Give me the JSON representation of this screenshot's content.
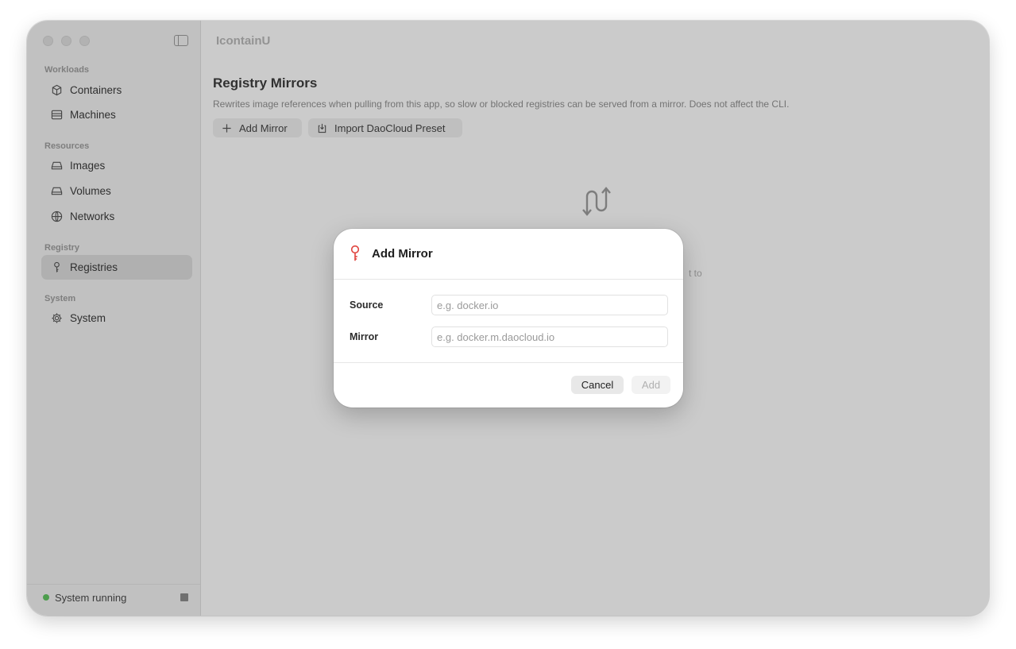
{
  "window": {
    "app_title": "IcontainU"
  },
  "sidebar": {
    "sections": [
      {
        "label": "Workloads",
        "items": [
          {
            "label": "Containers",
            "icon": "cube-icon"
          },
          {
            "label": "Machines",
            "icon": "server-icon"
          }
        ]
      },
      {
        "label": "Resources",
        "items": [
          {
            "label": "Images",
            "icon": "drive-icon"
          },
          {
            "label": "Volumes",
            "icon": "drive-icon"
          },
          {
            "label": "Networks",
            "icon": "globe-icon"
          }
        ]
      },
      {
        "label": "Registry",
        "items": [
          {
            "label": "Registries",
            "icon": "key-icon",
            "selected": true
          }
        ]
      },
      {
        "label": "System",
        "items": [
          {
            "label": "System",
            "icon": "gear-icon"
          }
        ]
      }
    ],
    "status": {
      "text": "System running",
      "color": "#5fc25f"
    }
  },
  "main": {
    "title": "Registry Mirrors",
    "description": "Rewrites image references when pulling from this app, so slow or blocked registries can be served from a mirror. Does not affect the CLI.",
    "add_mirror_label": "Add Mirror",
    "import_preset_label": "Import DaoCloud Preset",
    "empty_hint_fragment": "t to"
  },
  "dialog": {
    "title": "Add Mirror",
    "icon": "key-icon",
    "icon_color": "#e0443e",
    "source_label": "Source",
    "source_placeholder": "e.g. docker.io",
    "mirror_label": "Mirror",
    "mirror_placeholder": "e.g. docker.m.daocloud.io",
    "cancel_label": "Cancel",
    "add_label": "Add"
  }
}
